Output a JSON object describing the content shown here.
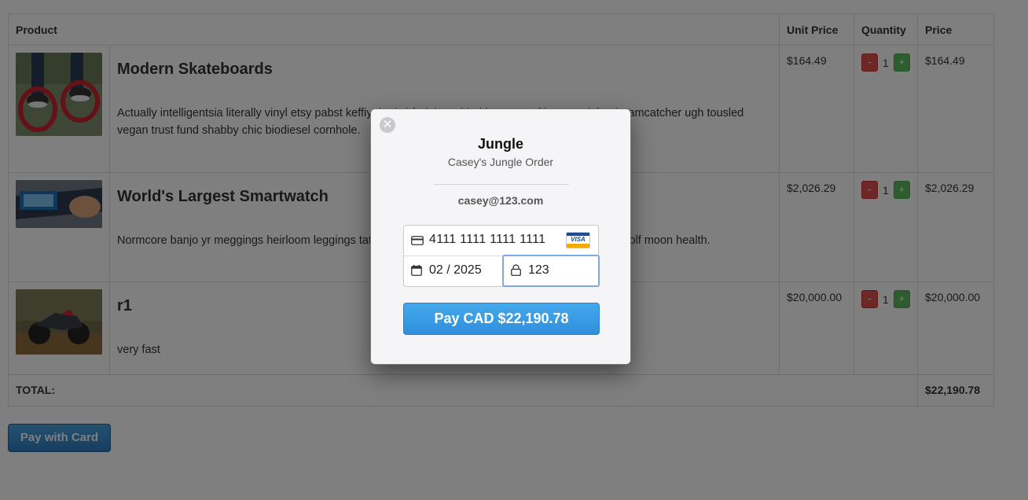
{
  "cart": {
    "headers": {
      "product": "Product",
      "unit_price": "Unit Price",
      "quantity": "Quantity",
      "price": "Price"
    },
    "items": [
      {
        "name": "Modern Skateboards",
        "description": "Actually intelligentsia literally vinyl etsy pabst keffiyeh pitchfork beard heirloom. Roof lomo +1 loko dreamcatcher ugh tousled vegan trust fund shabby chic biodiesel cornhole.",
        "unit_price": "$164.49",
        "quantity": "1",
        "price": "$164.49",
        "image_icon": "skateboard-photo"
      },
      {
        "name": "World's Largest Smartwatch",
        "description": "Normcore banjo yr meggings heirloom leggings tattooed brooklyn vegan cray. Single-origin coffee 3 wolf moon health.",
        "unit_price": "$2,026.29",
        "quantity": "1",
        "price": "$2,026.29",
        "image_icon": "smartwatch-photo"
      },
      {
        "name": "r1",
        "description": "very fast",
        "unit_price": "$20,000.00",
        "quantity": "1",
        "price": "$20,000.00",
        "image_icon": "motorcycle-photo"
      }
    ],
    "minus_label": "-",
    "plus_label": "+",
    "total_label": "TOTAL:",
    "total_value": "$22,190.78"
  },
  "pay_button_label": "Pay with Card",
  "checkout": {
    "close_glyph": "✕",
    "title": "Jungle",
    "subtitle": "Casey's Jungle Order",
    "email": "casey@123.com",
    "card_number": "4111 1111 1111 1111",
    "card_brand": "VISA",
    "expiry": "02 / 2025",
    "cvc": "123",
    "pay_label": "Pay CAD $22,190.78",
    "accent_color": "#3a9be5"
  }
}
